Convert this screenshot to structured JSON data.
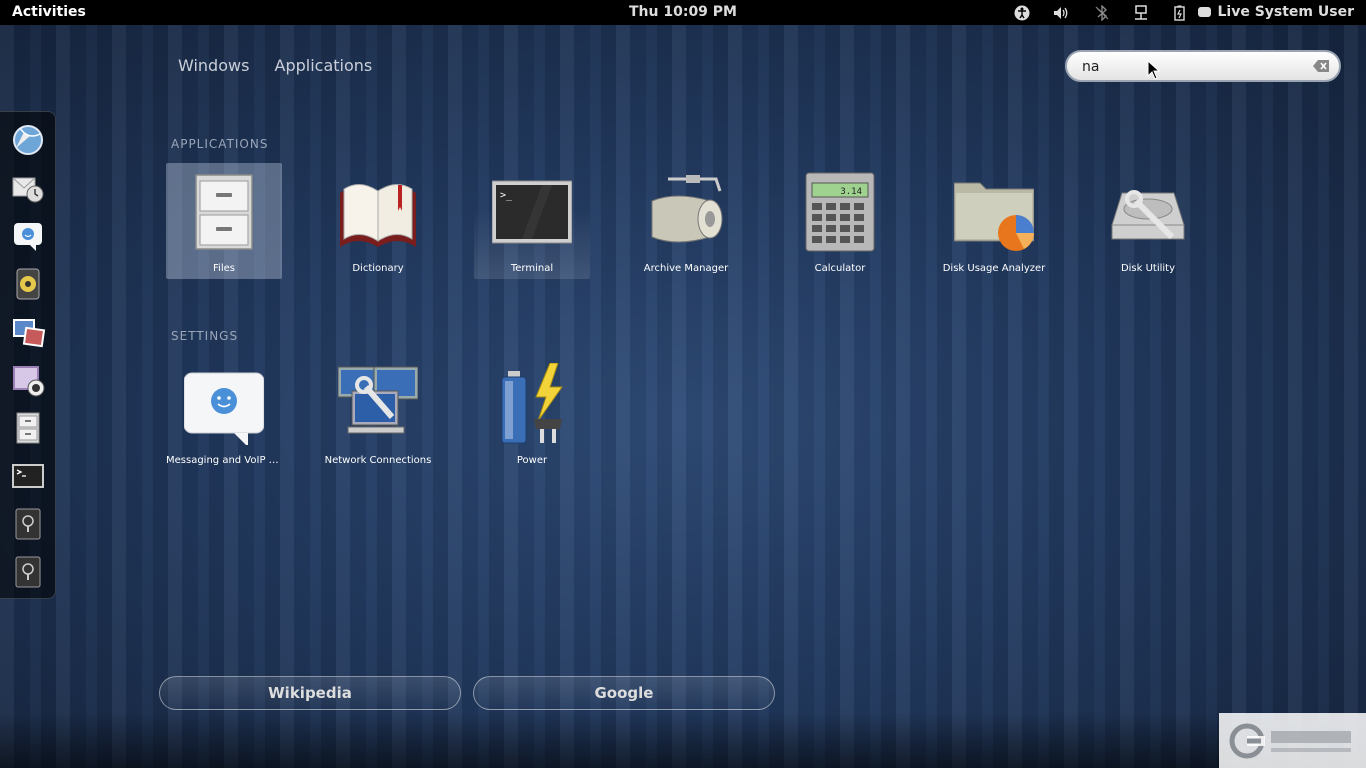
{
  "top_panel": {
    "activities_label": "Activities",
    "clock": "Thu 10:09 PM",
    "user_name": "Live System User",
    "tray_icons": [
      "accessibility-icon",
      "volume-icon",
      "bluetooth-icon",
      "network-icon",
      "battery-icon"
    ]
  },
  "view_tabs": {
    "windows": "Windows",
    "applications": "Applications"
  },
  "search": {
    "value": "na"
  },
  "dash": {
    "items": [
      "web-browser-icon",
      "evolution-mail-icon",
      "empathy-chat-icon",
      "rhythmbox-icon",
      "shotwell-photos-icon",
      "cheese-webcam-icon",
      "files-icon",
      "terminal-icon",
      "disk-drive-icon",
      "disk-drive-icon"
    ]
  },
  "sections": {
    "applications_title": "APPLICATIONS",
    "settings_title": "SETTINGS"
  },
  "applications": [
    {
      "label": "Files",
      "icon": "file-cabinet-icon"
    },
    {
      "label": "Dictionary",
      "icon": "book-icon"
    },
    {
      "label": "Terminal",
      "icon": "terminal-icon"
    },
    {
      "label": "Archive Manager",
      "icon": "archive-icon"
    },
    {
      "label": "Calculator",
      "icon": "calculator-icon"
    },
    {
      "label": "Disk Usage Analyzer",
      "icon": "folder-pie-icon"
    },
    {
      "label": "Disk Utility",
      "icon": "disk-utility-icon"
    }
  ],
  "settings": [
    {
      "label": "Messaging and VoIP A...",
      "icon": "chat-bubble-icon"
    },
    {
      "label": "Network Connections",
      "icon": "network-connections-icon"
    },
    {
      "label": "Power",
      "icon": "power-battery-icon"
    }
  ],
  "search_providers": {
    "wikipedia": "Wikipedia",
    "google": "Google"
  },
  "calculator_display": "3.14",
  "terminal_prompt": ">_",
  "colors": {
    "panel": "#000000",
    "background": "#223a60",
    "selection": "#d2def0"
  }
}
